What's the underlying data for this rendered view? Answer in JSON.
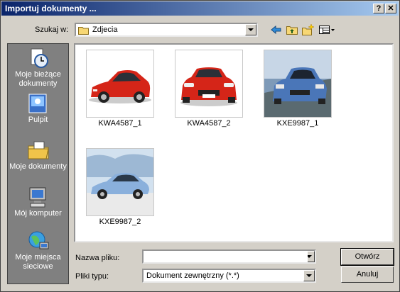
{
  "window": {
    "title": "Importuj dokumenty ...",
    "help_label": "?",
    "close_label": "✕"
  },
  "lookin": {
    "label": "Szukaj w:",
    "value": "Zdjecia"
  },
  "toolbar": {
    "back_icon": "back-arrow-icon",
    "up_icon": "up-folder-icon",
    "new_folder_icon": "new-folder-icon",
    "views_icon": "views-menu-icon"
  },
  "places": [
    {
      "label": "Moje bieżące dokumenty",
      "icon": "recent-documents-icon"
    },
    {
      "label": "Pulpit",
      "icon": "desktop-icon"
    },
    {
      "label": "Moje dokumenty",
      "icon": "my-documents-icon"
    },
    {
      "label": "Mój komputer",
      "icon": "my-computer-icon"
    },
    {
      "label": "Moje miejsca sieciowe",
      "icon": "network-places-icon"
    }
  ],
  "files": [
    {
      "name": "KWA4587_1",
      "thumb": "red hatchback side view"
    },
    {
      "name": "KWA4587_2",
      "thumb": "red hatchback front view"
    },
    {
      "name": "KXE9987_1",
      "thumb": "blue car front view"
    },
    {
      "name": "KXE9987_2",
      "thumb": "blue car side view"
    }
  ],
  "filename": {
    "label": "Nazwa pliku:",
    "value": ""
  },
  "filetype": {
    "label": "Pliki typu:",
    "value": "Dokument zewnętrzny (*.*)"
  },
  "buttons": {
    "open": "Otwórz",
    "cancel": "Anuluj"
  },
  "colors": {
    "title_start": "#0a246a",
    "title_end": "#a6caf0",
    "face": "#d4d0c8",
    "places_bg": "#808080"
  }
}
